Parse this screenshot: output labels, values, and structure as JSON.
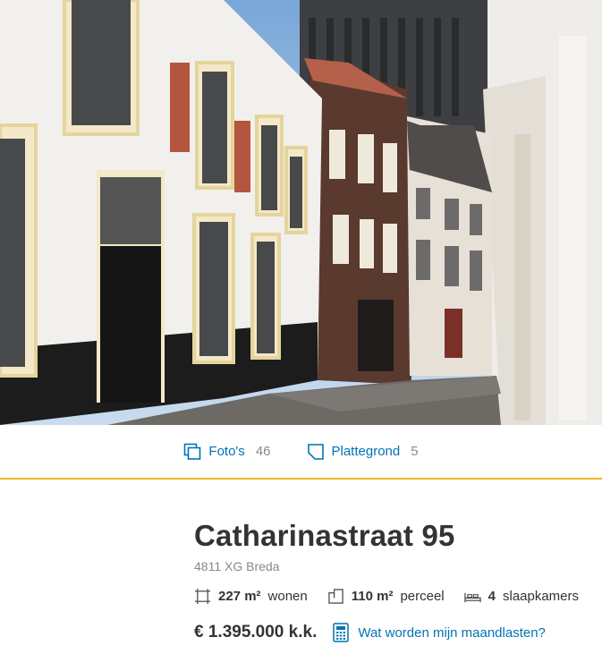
{
  "media_bar": {
    "photos_label": "Foto's",
    "photos_count": "46",
    "floorplan_label": "Plattegrond",
    "floorplan_count": "5"
  },
  "listing": {
    "title": "Catharinastraat 95",
    "address": "4811 XG Breda",
    "features": [
      {
        "icon": "living-area-icon",
        "value": "227 m²",
        "label": "wonen"
      },
      {
        "icon": "plot-area-icon",
        "value": "110 m²",
        "label": "perceel"
      },
      {
        "icon": "bed-icon",
        "value": "4",
        "label": "slaapkamers"
      }
    ],
    "price": "€ 1.395.000 k.k.",
    "mortgage_link": "Wat worden mijn maandlasten?"
  },
  "colors": {
    "link": "#0073b3",
    "accent_line": "#f0b429",
    "text": "#333333",
    "muted": "#888888"
  }
}
